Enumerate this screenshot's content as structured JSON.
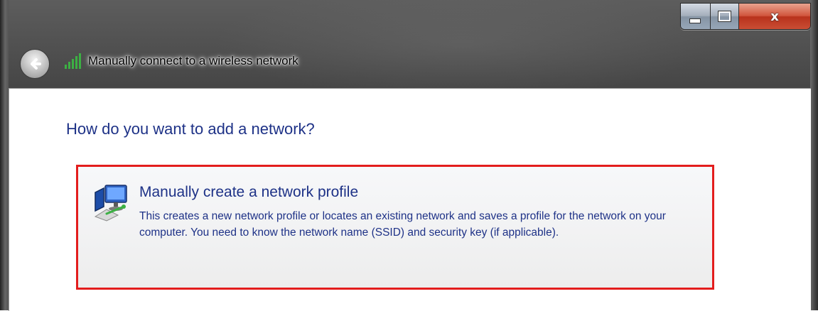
{
  "window": {
    "title": "Manually connect to a wireless network",
    "caption_buttons": {
      "minimize_icon": "minimize-icon",
      "maximize_icon": "maximize-icon",
      "close_glyph": "x"
    }
  },
  "main": {
    "heading": "How do you want to add a network?",
    "options": [
      {
        "title": "Manually create a network profile",
        "description": "This creates a new network profile or locates an existing network and saves a profile for the network on your computer. You need to know the network name (SSID) and security key (if applicable).",
        "icon": "network-computer-icon",
        "highlighted": true
      }
    ]
  },
  "colors": {
    "link_blue": "#1e3287",
    "highlight_red": "#e31d1d",
    "signal_green": "#3cb043"
  }
}
